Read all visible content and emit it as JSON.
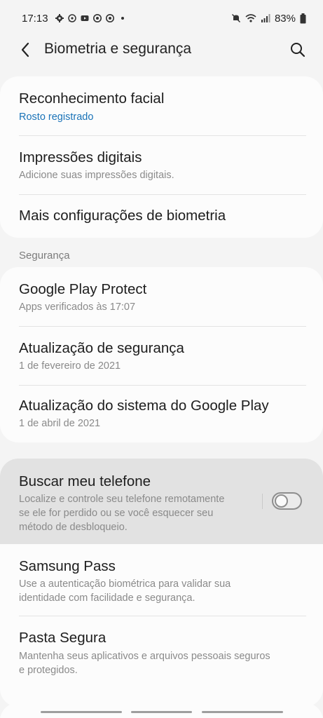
{
  "status_bar": {
    "time": "17:13",
    "left_icons": [
      "settings-gear",
      "whatsapp",
      "youtube",
      "chrome-like",
      "chrome-like",
      "dot"
    ],
    "battery": "83%"
  },
  "header": {
    "title": "Biometria e segurança",
    "back_icon": "chevron-left",
    "search_icon": "search"
  },
  "biometrics_card": {
    "items": [
      {
        "title": "Reconhecimento facial",
        "subtitle": "Rosto registrado"
      },
      {
        "title": "Impressões digitais",
        "subtitle": "Adicione suas impressões digitais."
      },
      {
        "title": "Mais configurações de biometria"
      }
    ]
  },
  "security_section": {
    "header": "Segurança",
    "items": [
      {
        "title": "Google Play Protect",
        "subtitle": "Apps verificados às 17:07"
      },
      {
        "title": "Atualização de segurança",
        "subtitle": "1 de fevereiro de 2021"
      },
      {
        "title": "Atualização do sistema do Google Play",
        "subtitle": "1 de abril de 2021"
      }
    ]
  },
  "other_card": {
    "items": [
      {
        "title": "Buscar meu telefone",
        "subtitle_lines": [
          "Localize e controle seu telefone remotamente",
          "se ele for perdido ou se você esquecer seu",
          "método de desbloqueio."
        ],
        "toggle_on": false
      },
      {
        "title": "Samsung Pass",
        "subtitle_lines": [
          "Use a autenticação biométrica para validar sua",
          "identidade com facilidade e segurança."
        ]
      },
      {
        "title": "Pasta Segura",
        "subtitle_lines": [
          "Mantenha seus aplicativos e arquivos pessoais seguros",
          "e protegidos."
        ]
      }
    ]
  },
  "colors": {
    "background": "#f4f4f4",
    "card": "#fcfcfc",
    "accent_blue": "#1a73b8",
    "highlight": "#e2e2e2"
  }
}
